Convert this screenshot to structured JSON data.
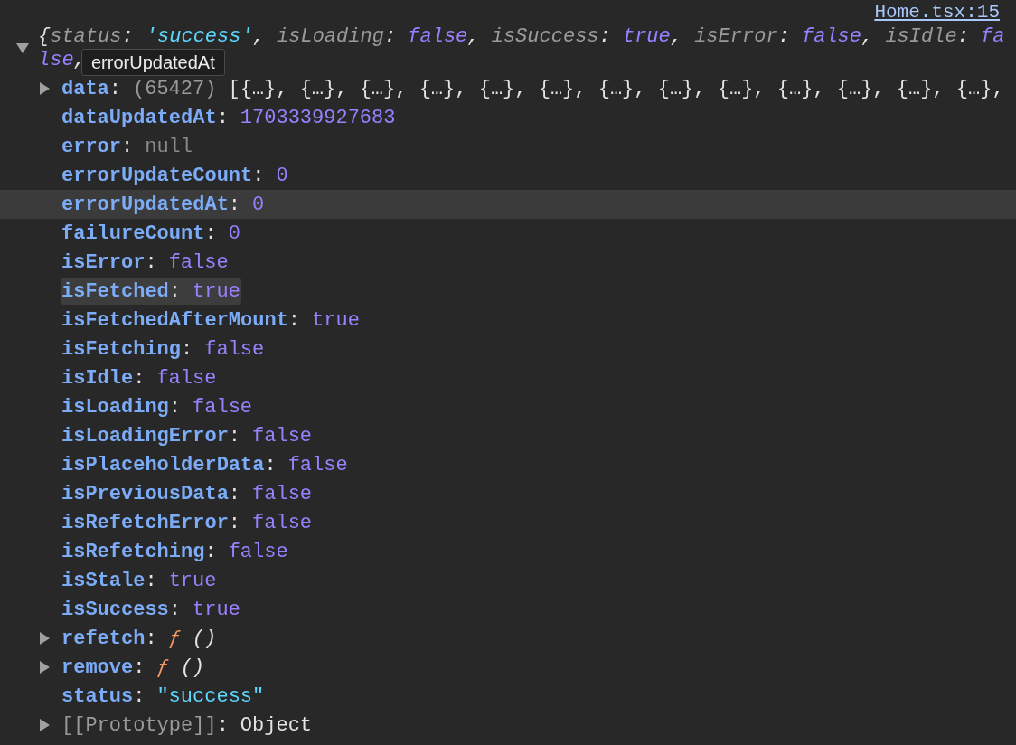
{
  "source_link": "Home.tsx:15",
  "object": {
    "expanded": true,
    "preview_lines": [
      [
        {
          "kind": "punct",
          "text": "{"
        },
        {
          "kind": "key",
          "text": "status"
        },
        {
          "kind": "punct",
          "text": ": "
        },
        {
          "kind": "string",
          "text": "'success'"
        },
        {
          "kind": "punct",
          "text": ", "
        },
        {
          "kind": "key",
          "text": "isLoading"
        },
        {
          "kind": "punct",
          "text": ": "
        },
        {
          "kind": "keyword",
          "text": "false"
        },
        {
          "kind": "punct",
          "text": ", "
        },
        {
          "kind": "key",
          "text": "isSuccess"
        },
        {
          "kind": "punct",
          "text": ": "
        },
        {
          "kind": "keyword",
          "text": "true"
        },
        {
          "kind": "punct",
          "text": ", "
        },
        {
          "kind": "key",
          "text": "isError"
        },
        {
          "kind": "punct",
          "text": ": "
        },
        {
          "kind": "keyword",
          "text": "false"
        },
        {
          "kind": "punct",
          "text": ", "
        },
        {
          "kind": "key",
          "text": "isIdle"
        },
        {
          "kind": "punct",
          "text": ": "
        },
        {
          "kind": "keyword",
          "text": "fa"
        }
      ],
      [
        {
          "kind": "keyword",
          "text": "lse"
        },
        {
          "kind": "punct",
          "text": ","
        }
      ]
    ],
    "tooltip": "errorUpdatedAt",
    "rows": [
      {
        "kind": "property",
        "key": "data",
        "colon": ":",
        "expandable": true,
        "count": "(65427)",
        "value": {
          "kind": "array",
          "text": "[{…}, {…}, {…}, {…}, {…}, {…}, {…}, {…}, {…}, {…}, {…}, {…}, {…},"
        },
        "selected": false,
        "hovered": false
      },
      {
        "kind": "property",
        "key": "dataUpdatedAt",
        "colon": ":",
        "expandable": false,
        "value": {
          "kind": "number",
          "text": "1703339927683"
        },
        "selected": false,
        "hovered": false
      },
      {
        "kind": "property",
        "key": "error",
        "colon": ":",
        "expandable": false,
        "value": {
          "kind": "null",
          "text": "null"
        },
        "selected": false,
        "hovered": false
      },
      {
        "kind": "property",
        "key": "errorUpdateCount",
        "colon": ":",
        "expandable": false,
        "value": {
          "kind": "number",
          "text": "0"
        },
        "selected": false,
        "hovered": false
      },
      {
        "kind": "property",
        "key": "errorUpdatedAt",
        "colon": ":",
        "expandable": false,
        "value": {
          "kind": "number",
          "text": "0"
        },
        "selected": true,
        "hovered": false
      },
      {
        "kind": "property",
        "key": "failureCount",
        "colon": ":",
        "expandable": false,
        "value": {
          "kind": "number",
          "text": "0"
        },
        "selected": false,
        "hovered": false
      },
      {
        "kind": "property",
        "key": "isError",
        "colon": ":",
        "expandable": false,
        "value": {
          "kind": "keyword",
          "text": "false"
        },
        "selected": false,
        "hovered": false
      },
      {
        "kind": "property",
        "key": "isFetched",
        "colon": ":",
        "expandable": false,
        "value": {
          "kind": "keyword",
          "text": "true"
        },
        "selected": false,
        "hovered": true
      },
      {
        "kind": "property",
        "key": "isFetchedAfterMount",
        "colon": ":",
        "expandable": false,
        "value": {
          "kind": "keyword",
          "text": "true"
        },
        "selected": false,
        "hovered": false
      },
      {
        "kind": "property",
        "key": "isFetching",
        "colon": ":",
        "expandable": false,
        "value": {
          "kind": "keyword",
          "text": "false"
        },
        "selected": false,
        "hovered": false
      },
      {
        "kind": "property",
        "key": "isIdle",
        "colon": ":",
        "expandable": false,
        "value": {
          "kind": "keyword",
          "text": "false"
        },
        "selected": false,
        "hovered": false
      },
      {
        "kind": "property",
        "key": "isLoading",
        "colon": ":",
        "expandable": false,
        "value": {
          "kind": "keyword",
          "text": "false"
        },
        "selected": false,
        "hovered": false
      },
      {
        "kind": "property",
        "key": "isLoadingError",
        "colon": ":",
        "expandable": false,
        "value": {
          "kind": "keyword",
          "text": "false"
        },
        "selected": false,
        "hovered": false
      },
      {
        "kind": "property",
        "key": "isPlaceholderData",
        "colon": ":",
        "expandable": false,
        "value": {
          "kind": "keyword",
          "text": "false"
        },
        "selected": false,
        "hovered": false
      },
      {
        "kind": "property",
        "key": "isPreviousData",
        "colon": ":",
        "expandable": false,
        "value": {
          "kind": "keyword",
          "text": "false"
        },
        "selected": false,
        "hovered": false
      },
      {
        "kind": "property",
        "key": "isRefetchError",
        "colon": ":",
        "expandable": false,
        "value": {
          "kind": "keyword",
          "text": "false"
        },
        "selected": false,
        "hovered": false
      },
      {
        "kind": "property",
        "key": "isRefetching",
        "colon": ":",
        "expandable": false,
        "value": {
          "kind": "keyword",
          "text": "false"
        },
        "selected": false,
        "hovered": false
      },
      {
        "kind": "property",
        "key": "isStale",
        "colon": ":",
        "expandable": false,
        "value": {
          "kind": "keyword",
          "text": "true"
        },
        "selected": false,
        "hovered": false
      },
      {
        "kind": "property",
        "key": "isSuccess",
        "colon": ":",
        "expandable": false,
        "value": {
          "kind": "keyword",
          "text": "true"
        },
        "selected": false,
        "hovered": false
      },
      {
        "kind": "property",
        "key": "refetch",
        "colon": ":",
        "expandable": true,
        "func_mark": "ƒ",
        "value": {
          "kind": "function",
          "text": "()"
        },
        "selected": false,
        "hovered": false
      },
      {
        "kind": "property",
        "key": "remove",
        "colon": ":",
        "expandable": true,
        "func_mark": "ƒ",
        "value": {
          "kind": "function",
          "text": "()"
        },
        "selected": false,
        "hovered": false
      },
      {
        "kind": "property",
        "key": "status",
        "colon": ":",
        "expandable": false,
        "value": {
          "kind": "string",
          "text": "\"success\""
        },
        "selected": false,
        "hovered": false
      },
      {
        "kind": "internal",
        "key": "[[Prototype]]",
        "colon": ":",
        "expandable": true,
        "value": {
          "kind": "object",
          "text": "Object"
        },
        "selected": false,
        "hovered": false
      }
    ]
  }
}
